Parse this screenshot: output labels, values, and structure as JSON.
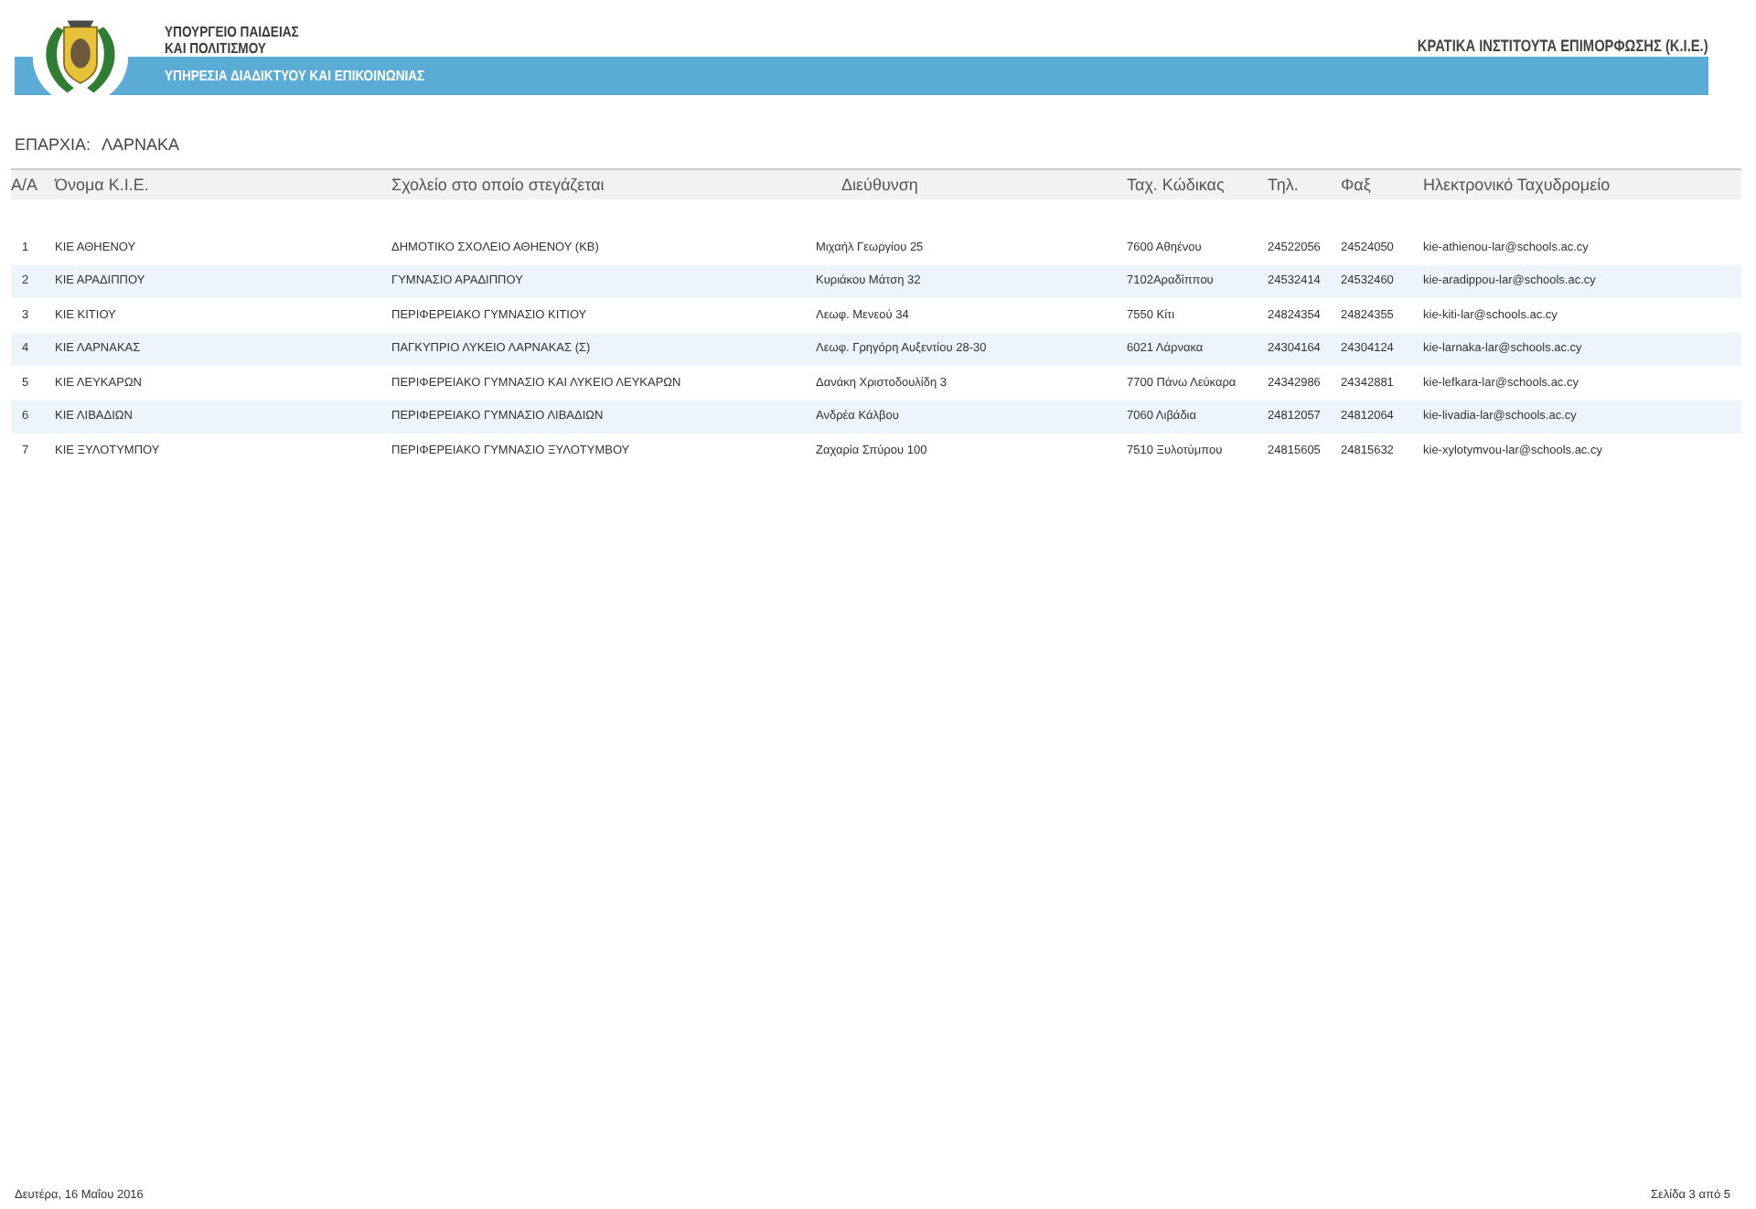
{
  "header": {
    "ministry_line_1": "ΥΠΟΥΡΓΕΙΟ ΠΑΙΔΕΙΑΣ",
    "ministry_line_2": "ΚΑΙ ΠΟΛΙΤΙΣΜΟΥ",
    "service": "ΥΠΗΡΕΣΙΑ ΔΙΑΔΙΚΤΥΟΥ ΚΑΙ ΕΠΙΚΟΙΝΩΝΙΑΣ",
    "report_title": "ΚΡΑΤΙΚΑ ΙΝΣΤΙΤΟΥΤΑ ΕΠΙΜΟΡΦΩΣΗΣ (Κ.Ι.Ε.)"
  },
  "district": {
    "label": "ΕΠΑΡΧΙΑ:",
    "value": "ΛΑΡΝΑΚΑ"
  },
  "table": {
    "columns": [
      "Α/Α",
      "Όνομα Κ.Ι.Ε.",
      "Σχολείο στο οποίο στεγάζεται",
      "Διεύθυνση",
      "Ταχ. Κώδικας",
      "Τηλ.",
      "Φαξ",
      "Ηλεκτρονικό Ταχυδρομείο"
    ],
    "rows": [
      [
        "1",
        "ΚΙΕ ΑΘΗΕΝΟΥ",
        "ΔΗΜΟΤΙΚΟ ΣΧΟΛΕΙΟ ΑΘΗΕΝΟΥ (ΚΒ)",
        "Μιχαήλ Γεωργίου 25",
        "7600 Αθηένου",
        "24522056",
        "24524050",
        "kie-athienou-lar@schools.ac.cy"
      ],
      [
        "2",
        "ΚΙΕ ΑΡΑΔΙΠΠΟΥ",
        "ΓΥΜΝΑΣΙΟ ΑΡΑΔΙΠΠΟΥ",
        "Κυριάκου Μάτση 32",
        "7102Αραδίππου",
        "24532414",
        "24532460",
        "kie-aradippou-lar@schools.ac.cy"
      ],
      [
        "3",
        "ΚΙΕ ΚΙΤΙΟΥ",
        "ΠΕΡΙΦΕΡΕΙΑΚΟ ΓΥΜΝΑΣΙΟ ΚΙΤΙΟΥ",
        "Λεωφ. Μενεού 34",
        "7550 Κίτι",
        "24824354",
        "24824355",
        "kie-kiti-lar@schools.ac.cy"
      ],
      [
        "4",
        "ΚΙΕ ΛΑΡΝΑΚΑΣ",
        "ΠΑΓΚΥΠΡΙΟ ΛΥΚΕΙΟ ΛΑΡΝΑΚΑΣ (Σ)",
        "Λεωφ. Γρηγόρη Αυξεντίου 28-30",
        "6021 Λάρνακα",
        "24304164",
        "24304124",
        "kie-larnaka-lar@schools.ac.cy"
      ],
      [
        "5",
        "ΚΙΕ ΛΕΥΚΑΡΩΝ",
        "ΠΕΡΙΦΕΡΕΙΑΚΟ ΓΥΜΝΑΣΙΟ ΚΑΙ ΛΥΚΕΙΟ ΛΕΥΚΑΡΩΝ",
        "Δανάκη Χριστοδουλίδη 3",
        "7700 Πάνω Λεύκαρα",
        "24342986",
        "24342881",
        "kie-lefkara-lar@schools.ac.cy"
      ],
      [
        "6",
        "ΚΙΕ ΛΙΒΑΔΙΩΝ",
        "ΠΕΡΙΦΕΡΕΙΑΚΟ ΓΥΜΝΑΣΙΟ ΛΙΒΑΔΙΩΝ",
        "Ανδρέα Κάλβου",
        "7060 Λιβάδια",
        "24812057",
        "24812064",
        "kie-livadia-lar@schools.ac.cy"
      ],
      [
        "7",
        "ΚΙΕ ΞΥΛΟΤΥΜΠΟΥ",
        "ΠΕΡΙΦΕΡΕΙΑΚΟ ΓΥΜΝΑΣΙΟ ΞΥΛΟΤΥΜΒΟΥ",
        "Ζαχαρία Σπύρου 100",
        "7510 Ξυλοτύμπου",
        "24815605",
        "24815632",
        "kie-xylotymvou-lar@schools.ac.cy"
      ]
    ]
  },
  "footer": {
    "date": "Δευτέρα, 16 Μαΐου 2016",
    "page": "Σελίδα 3 από 5"
  }
}
